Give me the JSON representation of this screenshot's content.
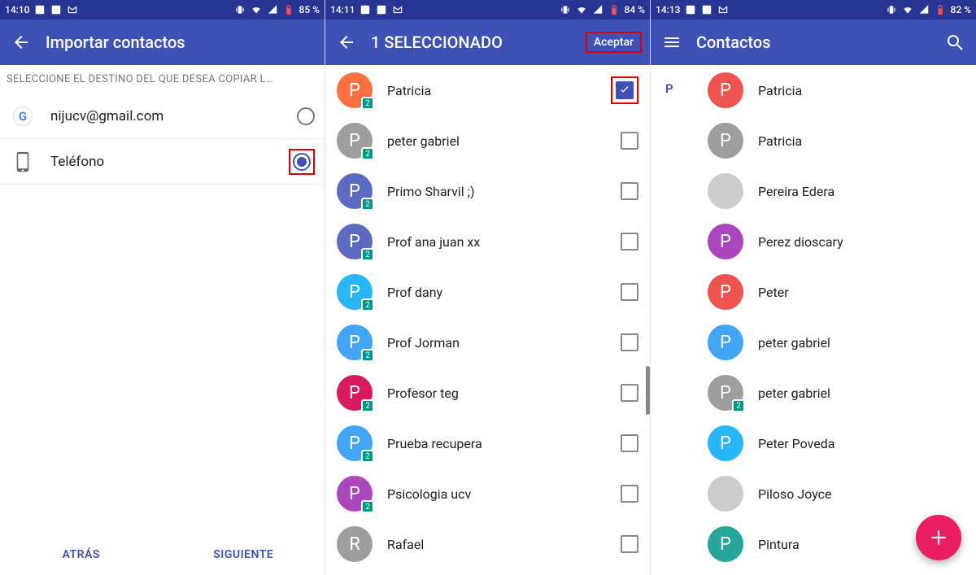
{
  "pane1": {
    "status": {
      "time": "14:10",
      "battery": "85 %"
    },
    "title": "Importar contactos",
    "subheader": "SELECCIONE EL DESTINO DEL QUE DESEA COPIAR L…",
    "destinations": [
      {
        "label": "nijucv@gmail.com",
        "icon": "google",
        "selected": false
      },
      {
        "label": "Teléfono",
        "icon": "phone",
        "selected": true,
        "highlight": true
      }
    ],
    "buttons": {
      "back": "ATRÁS",
      "next": "SIGUIENTE"
    }
  },
  "pane2": {
    "status": {
      "time": "14:11",
      "battery": "84 %"
    },
    "title": "1 SELECCIONADO",
    "accept": "Aceptar",
    "contacts": [
      {
        "name": "Patricia",
        "color": "c-orange",
        "badge": "2",
        "checked": true,
        "highlight": true
      },
      {
        "name": "peter gabriel",
        "color": "c-grey",
        "badge": "2",
        "checked": false
      },
      {
        "name": "Primo Sharvil ;)",
        "color": "c-indigo",
        "badge": "2",
        "checked": false
      },
      {
        "name": "Prof ana juan xx",
        "color": "c-indigo",
        "badge": "2",
        "checked": false
      },
      {
        "name": "Prof dany",
        "color": "c-cyan",
        "badge": "2",
        "checked": false
      },
      {
        "name": "Prof Jorman",
        "color": "c-lblue",
        "badge": "2",
        "checked": false
      },
      {
        "name": "Profesor teg",
        "color": "c-pink",
        "badge": "2",
        "checked": false
      },
      {
        "name": "Prueba recupera",
        "color": "c-lblue",
        "badge": "2",
        "checked": false
      },
      {
        "name": "Psicologia ucv",
        "color": "c-purple",
        "badge": "2",
        "checked": false
      },
      {
        "name": "Rafael",
        "color": "c-grey",
        "badge": "",
        "checked": false
      }
    ]
  },
  "pane3": {
    "status": {
      "time": "14:13",
      "battery": "82 %"
    },
    "title": "Contactos",
    "index_letter": "P",
    "contacts": [
      {
        "name": "Patricia",
        "color": "c-red",
        "badge": ""
      },
      {
        "name": "Patricia",
        "color": "c-grey",
        "badge": ""
      },
      {
        "name": "Pereira Edera",
        "color": "photo photo1",
        "badge": ""
      },
      {
        "name": "Perez dioscary",
        "color": "c-purple",
        "badge": ""
      },
      {
        "name": "Peter",
        "color": "c-red",
        "badge": ""
      },
      {
        "name": "peter gabriel",
        "color": "c-lblue",
        "badge": ""
      },
      {
        "name": "peter gabriel",
        "color": "c-grey",
        "badge": "2"
      },
      {
        "name": "Peter Poveda",
        "color": "c-cyan",
        "badge": ""
      },
      {
        "name": "Piloso Joyce",
        "color": "photo photo2",
        "badge": ""
      },
      {
        "name": "Pintura",
        "color": "c-teal",
        "badge": ""
      }
    ]
  }
}
